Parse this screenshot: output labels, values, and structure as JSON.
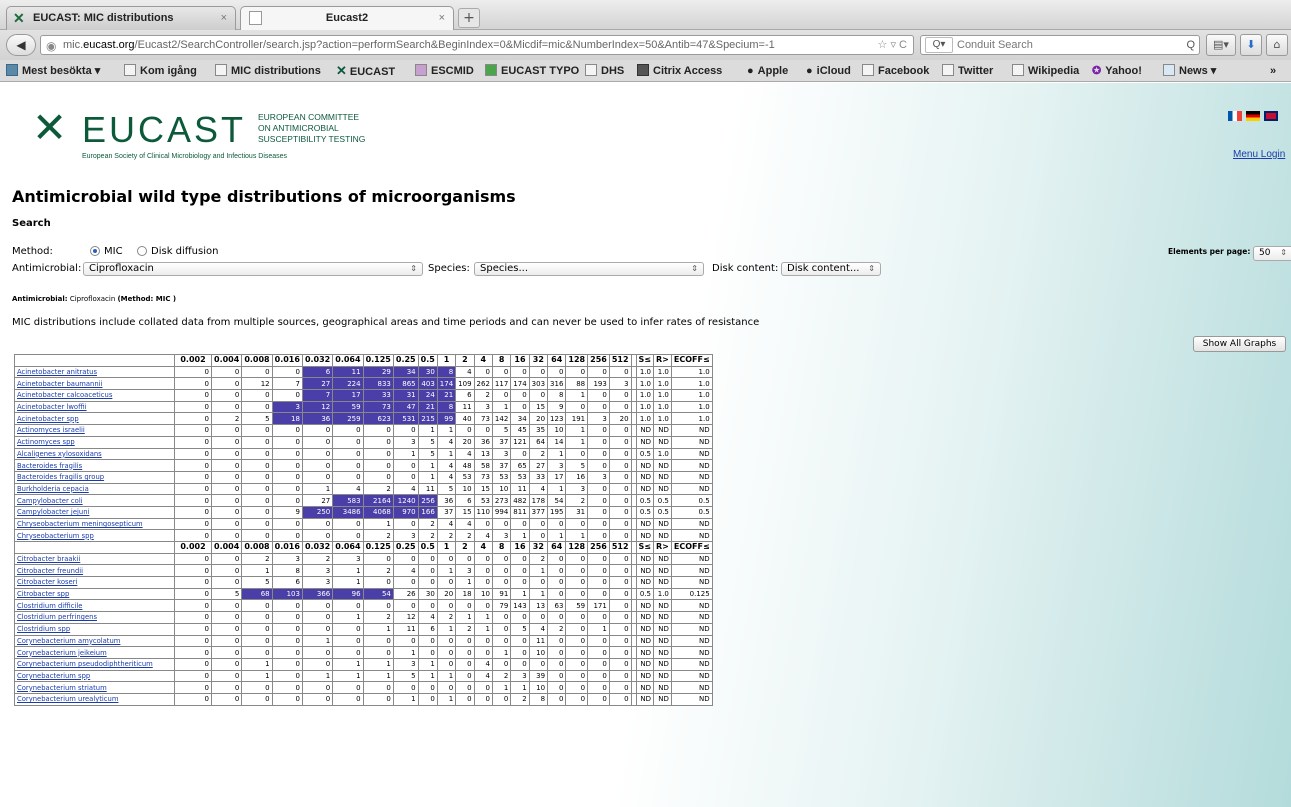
{
  "browser": {
    "tabs": [
      {
        "label": "EUCAST: MIC distributions",
        "close": "×"
      },
      {
        "label": "Eucast2",
        "close": "×"
      }
    ],
    "new_tab": "+",
    "back": "◀",
    "url_prefix": "mic.",
    "url_domain": "eucast.org",
    "url_rest": "/Eucast2/SearchController/search.jsp?action=performSearch&BeginIndex=0&Micdif=mic&NumberIndex=50&Antib=47&Specium=-1",
    "url_controls": "☆ ▿ C",
    "search_engine": "Q▾",
    "search_placeholder": "Conduit Search",
    "search_icon": "Q",
    "bookmarks_btn": "▤▾",
    "download_btn": "⬇",
    "home_btn": "⌂",
    "bookmarks": [
      "Mest besökta ▾",
      "Kom igång",
      "MIC distributions",
      "EUCAST",
      "ESCMID",
      "EUCAST TYPO",
      "DHS",
      "Citrix Access",
      "Apple",
      "iCloud",
      "Facebook",
      "Twitter",
      "Wikipedia",
      "Yahoo!",
      "News ▾"
    ],
    "bookmarks_more": "»"
  },
  "header": {
    "logo_mark": "✕",
    "logo_text": "EUCAST",
    "logo_sub": [
      "EUROPEAN COMMITTEE",
      "ON ANTIMICROBIAL",
      "SUSCEPTIBILITY TESTING"
    ],
    "logo_line": "European Society of Clinical Microbiology and Infectious Diseases",
    "menu": "Menu",
    "login": "Login"
  },
  "title": "Antimicrobial wild type distributions of microorganisms",
  "search": {
    "heading": "Search",
    "method_label": "Method:",
    "method_mic": "MIC",
    "method_disk": "Disk diffusion",
    "antimicrobial_label": "Antimicrobial:",
    "antimicrobial_value": "Ciprofloxacin",
    "species_label": "Species:",
    "species_value": "Species...",
    "disk_label": "Disk content:",
    "disk_value": "Disk content...",
    "elements_label": "Elements per page:",
    "elements_value": "50"
  },
  "selection_key": "Antimicrobial:",
  "selection_value": "Ciprofloxacin",
  "selection_method": "(Method: MIC )",
  "note": "MIC distributions include collated data from multiple sources, geographical areas and time periods and can never be used to infer rates of resistance",
  "show_all_graphs": "Show All Graphs",
  "table": {
    "headers": [
      "0.002",
      "0.004",
      "0.008",
      "0.016",
      "0.032",
      "0.064",
      "0.125",
      "0.25",
      "0.5",
      "1",
      "2",
      "4",
      "8",
      "16",
      "32",
      "64",
      "128",
      "256",
      "512"
    ],
    "tail_headers": [
      "S≤",
      "R>",
      "ECOFF≤"
    ],
    "rows": [
      {
        "species": "Acinetobacter anitratus",
        "values": [
          "0",
          "0",
          "0",
          "0",
          "6",
          "11",
          "29",
          "34",
          "30",
          "8",
          "4",
          "0",
          "0",
          "0",
          "0",
          "0",
          "0",
          "0",
          "0"
        ],
        "hl": [
          4,
          9
        ],
        "tail": [
          "1.0",
          "1.0",
          "1.0"
        ]
      },
      {
        "species": "Acinetobacter baumannii",
        "values": [
          "0",
          "0",
          "12",
          "7",
          "27",
          "224",
          "833",
          "865",
          "403",
          "174",
          "109",
          "262",
          "117",
          "174",
          "303",
          "316",
          "88",
          "193",
          "3"
        ],
        "hl": [
          4,
          9
        ],
        "tail": [
          "1.0",
          "1.0",
          "1.0"
        ]
      },
      {
        "species": "Acinetobacter calcoaceticus",
        "values": [
          "0",
          "0",
          "0",
          "0",
          "7",
          "17",
          "33",
          "31",
          "24",
          "21",
          "6",
          "2",
          "0",
          "0",
          "0",
          "8",
          "1",
          "0",
          "0"
        ],
        "hl": [
          4,
          9
        ],
        "tail": [
          "1.0",
          "1.0",
          "1.0"
        ]
      },
      {
        "species": "Acinetobacter lwoffii",
        "values": [
          "0",
          "0",
          "0",
          "3",
          "12",
          "59",
          "73",
          "47",
          "21",
          "8",
          "11",
          "3",
          "1",
          "0",
          "15",
          "9",
          "0",
          "0",
          "0"
        ],
        "hl": [
          3,
          9
        ],
        "tail": [
          "1.0",
          "1.0",
          "1.0"
        ]
      },
      {
        "species": "Acinetobacter spp",
        "values": [
          "0",
          "2",
          "5",
          "18",
          "36",
          "259",
          "623",
          "531",
          "215",
          "99",
          "40",
          "73",
          "142",
          "34",
          "20",
          "123",
          "191",
          "3",
          "20"
        ],
        "hl": [
          3,
          9
        ],
        "tail": [
          "1.0",
          "1.0",
          "1.0"
        ]
      },
      {
        "species": "Actinomyces israelii",
        "values": [
          "0",
          "0",
          "0",
          "0",
          "0",
          "0",
          "0",
          "0",
          "1",
          "1",
          "0",
          "0",
          "5",
          "45",
          "35",
          "10",
          "1",
          "0",
          "0"
        ],
        "hl": null,
        "tail": [
          "ND",
          "ND",
          "ND"
        ]
      },
      {
        "species": "Actinomyces spp",
        "values": [
          "0",
          "0",
          "0",
          "0",
          "0",
          "0",
          "0",
          "3",
          "5",
          "4",
          "20",
          "36",
          "37",
          "121",
          "64",
          "14",
          "1",
          "0",
          "0"
        ],
        "hl": null,
        "tail": [
          "ND",
          "ND",
          "ND"
        ]
      },
      {
        "species": "Alcaligenes xylosoxidans",
        "values": [
          "0",
          "0",
          "0",
          "0",
          "0",
          "0",
          "0",
          "1",
          "5",
          "1",
          "4",
          "13",
          "3",
          "0",
          "2",
          "1",
          "0",
          "0",
          "0"
        ],
        "hl": null,
        "tail": [
          "0.5",
          "1.0",
          "ND"
        ]
      },
      {
        "species": "Bacteroides fragilis",
        "values": [
          "0",
          "0",
          "0",
          "0",
          "0",
          "0",
          "0",
          "0",
          "1",
          "4",
          "48",
          "58",
          "37",
          "65",
          "27",
          "3",
          "5",
          "0",
          "0"
        ],
        "hl": null,
        "tail": [
          "ND",
          "ND",
          "ND"
        ]
      },
      {
        "species": "Bacteroides fragilis group",
        "values": [
          "0",
          "0",
          "0",
          "0",
          "0",
          "0",
          "0",
          "0",
          "1",
          "4",
          "53",
          "73",
          "53",
          "53",
          "33",
          "17",
          "16",
          "3",
          "0"
        ],
        "hl": null,
        "tail": [
          "ND",
          "ND",
          "ND"
        ]
      },
      {
        "species": "Burkholderia cepacia",
        "values": [
          "0",
          "0",
          "0",
          "0",
          "1",
          "4",
          "2",
          "4",
          "11",
          "5",
          "10",
          "15",
          "10",
          "11",
          "4",
          "1",
          "3",
          "0",
          "0"
        ],
        "hl": null,
        "tail": [
          "ND",
          "ND",
          "ND"
        ]
      },
      {
        "species": "Campylobacter coli",
        "values": [
          "0",
          "0",
          "0",
          "0",
          "27",
          "583",
          "2164",
          "1240",
          "256",
          "36",
          "6",
          "53",
          "273",
          "482",
          "178",
          "54",
          "2",
          "0",
          "0"
        ],
        "hl": [
          5,
          8
        ],
        "tail": [
          "0.5",
          "0.5",
          "0.5"
        ]
      },
      {
        "species": "Campylobacter jejuni",
        "values": [
          "0",
          "0",
          "0",
          "9",
          "250",
          "3486",
          "4068",
          "970",
          "166",
          "37",
          "15",
          "110",
          "994",
          "811",
          "377",
          "195",
          "31",
          "0",
          "0"
        ],
        "hl": [
          4,
          8
        ],
        "tail": [
          "0.5",
          "0.5",
          "0.5"
        ]
      },
      {
        "species": "Chryseobacterium meningosepticum",
        "values": [
          "0",
          "0",
          "0",
          "0",
          "0",
          "0",
          "1",
          "0",
          "2",
          "4",
          "4",
          "0",
          "0",
          "0",
          "0",
          "0",
          "0",
          "0",
          "0"
        ],
        "hl": null,
        "tail": [
          "ND",
          "ND",
          "ND"
        ]
      },
      {
        "species": "Chryseobacterium spp",
        "values": [
          "0",
          "0",
          "0",
          "0",
          "0",
          "0",
          "2",
          "3",
          "2",
          "2",
          "2",
          "4",
          "3",
          "1",
          "0",
          "1",
          "1",
          "0",
          "0"
        ],
        "hl": null,
        "tail": [
          "ND",
          "ND",
          "ND"
        ]
      },
      {
        "header": true
      },
      {
        "species": "Citrobacter braakii",
        "values": [
          "0",
          "0",
          "2",
          "3",
          "2",
          "3",
          "0",
          "0",
          "0",
          "0",
          "0",
          "0",
          "0",
          "0",
          "2",
          "0",
          "0",
          "0",
          "0"
        ],
        "hl": null,
        "tail": [
          "ND",
          "ND",
          "ND"
        ]
      },
      {
        "species": "Citrobacter freundii",
        "values": [
          "0",
          "0",
          "1",
          "8",
          "3",
          "1",
          "2",
          "4",
          "0",
          "1",
          "3",
          "0",
          "0",
          "0",
          "1",
          "0",
          "0",
          "0",
          "0"
        ],
        "hl": null,
        "tail": [
          "ND",
          "ND",
          "ND"
        ]
      },
      {
        "species": "Citrobacter koseri",
        "values": [
          "0",
          "0",
          "5",
          "6",
          "3",
          "1",
          "0",
          "0",
          "0",
          "0",
          "1",
          "0",
          "0",
          "0",
          "0",
          "0",
          "0",
          "0",
          "0"
        ],
        "hl": null,
        "tail": [
          "ND",
          "ND",
          "ND"
        ]
      },
      {
        "species": "Citrobacter spp",
        "values": [
          "0",
          "5",
          "68",
          "103",
          "366",
          "96",
          "54",
          "26",
          "30",
          "20",
          "18",
          "10",
          "91",
          "1",
          "1",
          "0",
          "0",
          "0",
          "0"
        ],
        "hl": [
          2,
          6
        ],
        "tail": [
          "0.5",
          "1.0",
          "0.125"
        ]
      },
      {
        "species": "Clostridium difficile",
        "values": [
          "0",
          "0",
          "0",
          "0",
          "0",
          "0",
          "0",
          "0",
          "0",
          "0",
          "0",
          "0",
          "79",
          "143",
          "13",
          "63",
          "59",
          "171",
          "0"
        ],
        "hl": null,
        "tail": [
          "ND",
          "ND",
          "ND"
        ]
      },
      {
        "species": "Clostridium perfringens",
        "values": [
          "0",
          "0",
          "0",
          "0",
          "0",
          "1",
          "2",
          "12",
          "4",
          "2",
          "1",
          "1",
          "0",
          "0",
          "0",
          "0",
          "0",
          "0",
          "0"
        ],
        "hl": null,
        "tail": [
          "ND",
          "ND",
          "ND"
        ]
      },
      {
        "species": "Clostridium spp",
        "values": [
          "0",
          "0",
          "0",
          "0",
          "0",
          "0",
          "1",
          "11",
          "6",
          "1",
          "2",
          "1",
          "0",
          "5",
          "4",
          "2",
          "0",
          "1",
          "0"
        ],
        "hl": null,
        "tail": [
          "ND",
          "ND",
          "ND"
        ]
      },
      {
        "species": "Corynebacterium amycolatum",
        "values": [
          "0",
          "0",
          "0",
          "0",
          "1",
          "0",
          "0",
          "0",
          "0",
          "0",
          "0",
          "0",
          "0",
          "0",
          "11",
          "0",
          "0",
          "0",
          "0"
        ],
        "hl": null,
        "tail": [
          "ND",
          "ND",
          "ND"
        ]
      },
      {
        "species": "Corynebacterium jeikeium",
        "values": [
          "0",
          "0",
          "0",
          "0",
          "0",
          "0",
          "0",
          "1",
          "0",
          "0",
          "0",
          "0",
          "1",
          "0",
          "10",
          "0",
          "0",
          "0",
          "0"
        ],
        "hl": null,
        "tail": [
          "ND",
          "ND",
          "ND"
        ]
      },
      {
        "species": "Corynebacterium pseudodiphtheriticum",
        "values": [
          "0",
          "0",
          "1",
          "0",
          "0",
          "1",
          "1",
          "3",
          "1",
          "0",
          "0",
          "4",
          "0",
          "0",
          "0",
          "0",
          "0",
          "0",
          "0"
        ],
        "hl": null,
        "tail": [
          "ND",
          "ND",
          "ND"
        ]
      },
      {
        "species": "Corynebacterium spp",
        "values": [
          "0",
          "0",
          "1",
          "0",
          "1",
          "1",
          "1",
          "5",
          "1",
          "1",
          "0",
          "4",
          "2",
          "3",
          "39",
          "0",
          "0",
          "0",
          "0"
        ],
        "hl": null,
        "tail": [
          "ND",
          "ND",
          "ND"
        ]
      },
      {
        "species": "Corynebacterium striatum",
        "values": [
          "0",
          "0",
          "0",
          "0",
          "0",
          "0",
          "0",
          "0",
          "0",
          "0",
          "0",
          "0",
          "1",
          "1",
          "10",
          "0",
          "0",
          "0",
          "0"
        ],
        "hl": null,
        "tail": [
          "ND",
          "ND",
          "ND"
        ]
      },
      {
        "species": "Corynebacterium urealyticum",
        "values": [
          "0",
          "0",
          "0",
          "0",
          "0",
          "0",
          "0",
          "1",
          "0",
          "1",
          "0",
          "0",
          "0",
          "2",
          "8",
          "0",
          "0",
          "0",
          "0"
        ],
        "hl": null,
        "tail": [
          "ND",
          "ND",
          "ND"
        ]
      }
    ]
  },
  "colors": {
    "highlight": "#4a3fa8",
    "link": "#1a3caa",
    "brand": "#0c5a3a"
  }
}
